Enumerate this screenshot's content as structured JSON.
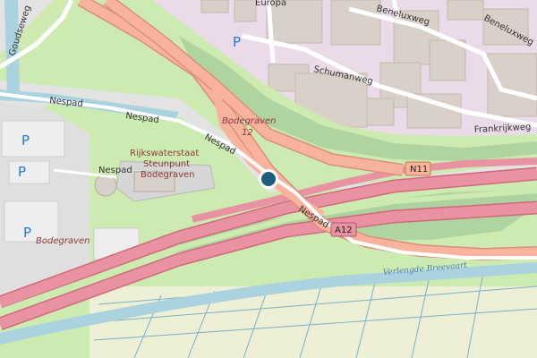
{
  "map": {
    "streets": {
      "goudseweg": "Goudseweg",
      "europa": "Europa",
      "beneluxweg_1": "Beneluxweg",
      "beneluxweg_2": "Beneluxweg",
      "schumanweg": "Schumanweg",
      "frankrijkweg": "Frankrijkweg",
      "nespad_1": "Nespad",
      "nespad_2": "Nespad",
      "nespad_3": "Nespad",
      "nespad_4": "Nespad",
      "nespad_5": "Nespad"
    },
    "places": {
      "bodegraven_12_line1": "Bodegraven",
      "bodegraven_12_line2": "12",
      "bodegraven": "Bodegraven",
      "rws_line1": "Rijkswaterstaat",
      "rws_line2": "Steunpunt",
      "rws_line3": "Bodegraven"
    },
    "water": {
      "verlengde_breevaart": "Verlengde Breevaart"
    },
    "shields": {
      "n11": "N11",
      "a12": "A12"
    },
    "parking_symbol": "P",
    "colors": {
      "motorway": "#e892a2",
      "trunk": "#f9b29c",
      "grass": "#cdebb0",
      "industrial": "#ebdbe8",
      "water": "#aad3df",
      "marker": "#1d5f7a"
    }
  }
}
